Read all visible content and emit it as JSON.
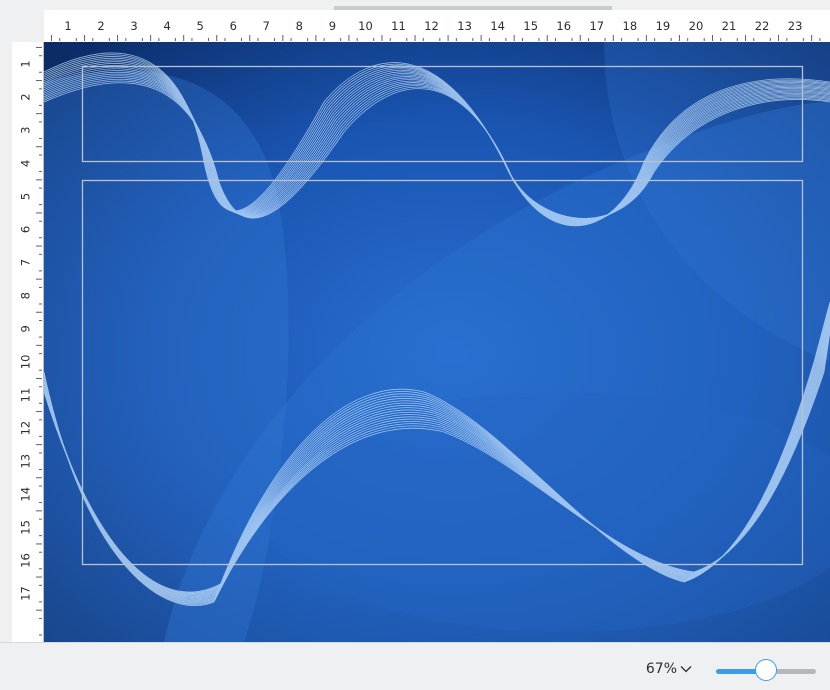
{
  "ruler": {
    "horizontal_ticks": [
      "1",
      "2",
      "3",
      "4",
      "5",
      "6",
      "7",
      "8",
      "9",
      "10",
      "11",
      "12",
      "13",
      "14",
      "15",
      "16",
      "17",
      "18",
      "19",
      "20",
      "21",
      "22",
      "23"
    ],
    "vertical_ticks": [
      "1",
      "2",
      "3",
      "4",
      "5",
      "6",
      "7",
      "8",
      "9",
      "10",
      "11",
      "12",
      "13",
      "14",
      "15",
      "16",
      "17"
    ],
    "unit": "cm"
  },
  "slide": {
    "background": "blue-wave-abstract",
    "colors": {
      "dark": "#0d2f70",
      "mid": "#1b57b5",
      "light": "#3a7fd6",
      "wave": "#bfe0ff"
    },
    "placeholders": [
      "title-placeholder",
      "content-placeholder"
    ]
  },
  "statusbar": {
    "zoom_label": "67%",
    "zoom_dropdown_icon": "chevron-down-icon",
    "zoom_level": 0.5,
    "accent": "#3d9ee5"
  }
}
